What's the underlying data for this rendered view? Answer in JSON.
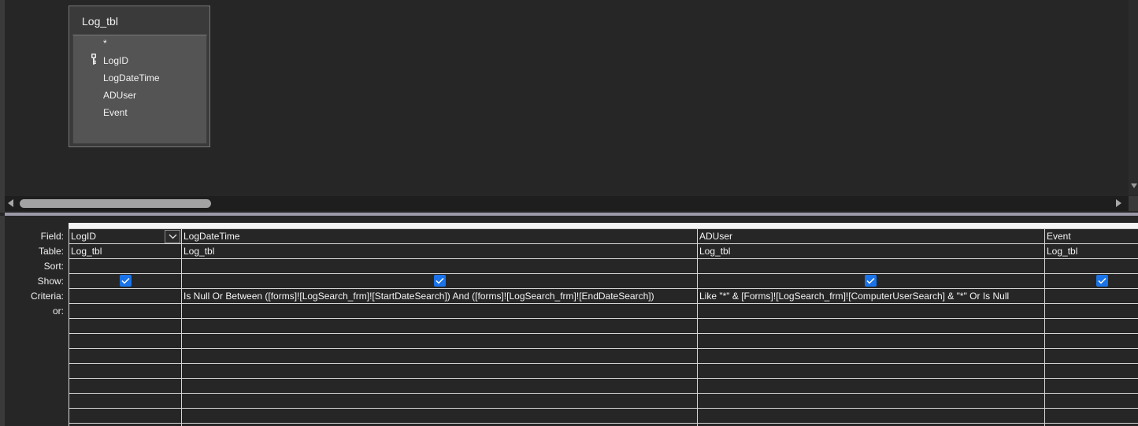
{
  "field_list": {
    "table_name": "Log_tbl",
    "fields": [
      "*",
      "LogID",
      "LogDateTime",
      "ADUser",
      "Event"
    ],
    "primary_key_field": "LogID"
  },
  "grid": {
    "row_labels": [
      "Field:",
      "Table:",
      "Sort:",
      "Show:",
      "Criteria:",
      "or:"
    ],
    "columns": [
      {
        "field": "LogID",
        "table": "Log_tbl",
        "sort": "",
        "show": true,
        "criteria": "",
        "or": ""
      },
      {
        "field": "LogDateTime",
        "table": "Log_tbl",
        "sort": "",
        "show": true,
        "criteria": "Is Null Or Between ([forms]![LogSearch_frm]![StartDateSearch]) And ([forms]![LogSearch_frm]![EndDateSearch])",
        "or": ""
      },
      {
        "field": "ADUser",
        "table": "Log_tbl",
        "sort": "",
        "show": true,
        "criteria": "Like \"*\" & [Forms]![LogSearch_frm]![ComputerUserSearch] & \"*\" Or Is Null",
        "or": ""
      },
      {
        "field": "Event",
        "table": "Log_tbl",
        "sort": "",
        "show": true,
        "criteria": "",
        "or": ""
      }
    ]
  },
  "colors": {
    "background": "#262626",
    "grid_line": "#d6d6d6",
    "checkbox": "#1a73e8",
    "field_list_bg": "#545454",
    "splitter": "#9c99a8"
  }
}
